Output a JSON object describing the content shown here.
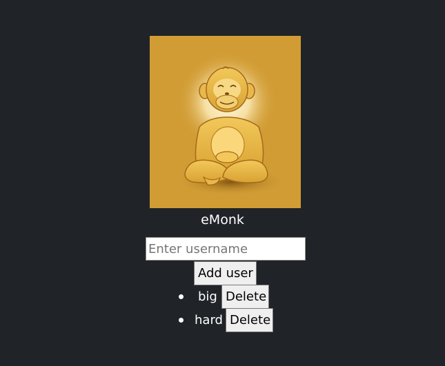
{
  "app": {
    "title": "eMonk",
    "logo_icon": "meditating-monkey-icon"
  },
  "form": {
    "username_placeholder": "Enter username",
    "username_value": "",
    "add_label": "Add user"
  },
  "users": [
    {
      "name": "big",
      "delete_label": "Delete"
    },
    {
      "name": "hard",
      "delete_label": "Delete"
    }
  ],
  "colors": {
    "background": "#202327",
    "logo_background": "#d19c34",
    "text": "#ffffff",
    "button_bg": "#efefef"
  }
}
